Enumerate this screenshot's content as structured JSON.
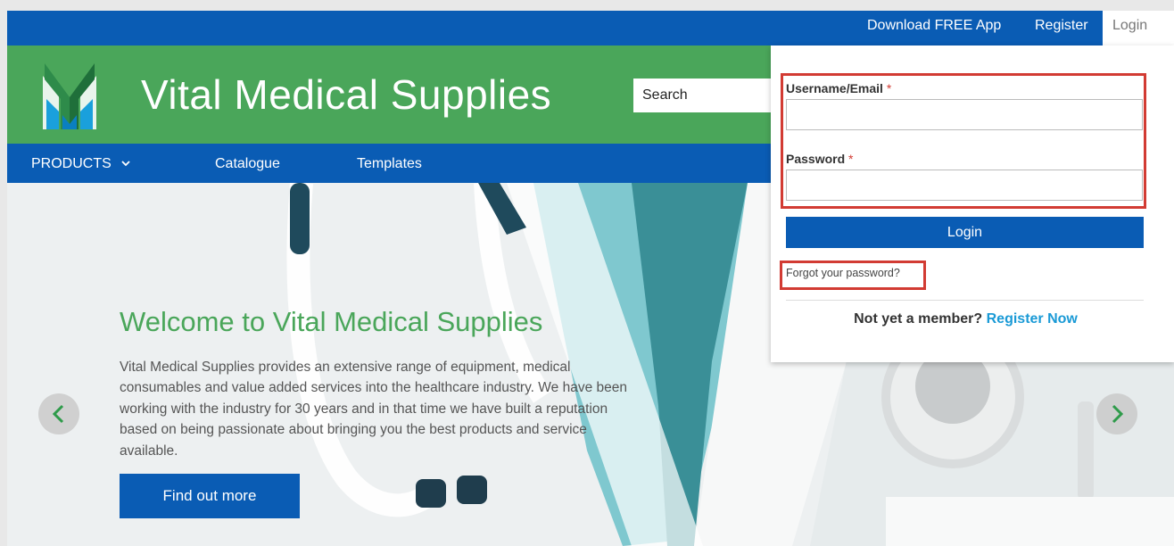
{
  "topbar": {
    "download_app": "Download FREE App",
    "register": "Register",
    "login": "Login"
  },
  "header": {
    "brand": "Vital Medical Supplies",
    "search_placeholder": "Search"
  },
  "nav": {
    "products": "PRODUCTS",
    "catalogue": "Catalogue",
    "templates": "Templates"
  },
  "hero": {
    "title": "Welcome to Vital Medical Supplies",
    "body": "Vital Medical Supplies provides an extensive range of equipment, medical consumables and value added services into the healthcare industry. We have been working with the industry for 30 years and in that time we have built a reputation based on being passionate about bringing you the best products and service available.",
    "cta": "Find out more"
  },
  "login_form": {
    "username_label": "Username/Email",
    "password_label": "Password",
    "required_mark": "*",
    "submit": "Login",
    "forgot": "Forgot your password?",
    "not_member": "Not yet a member?",
    "register_now": "Register Now"
  },
  "colors": {
    "brand_blue": "#0a5cb4",
    "brand_green": "#4aa65a",
    "highlight_red": "#d23b33",
    "link_blue": "#1a9ad6"
  }
}
